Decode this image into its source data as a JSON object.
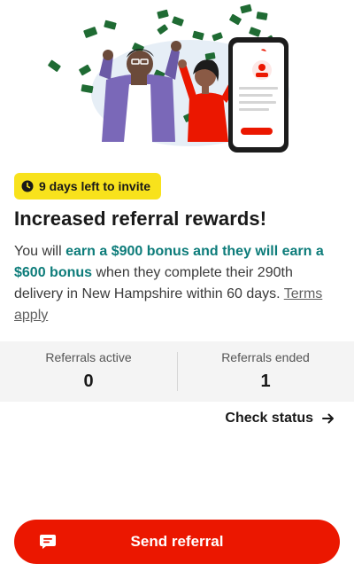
{
  "invite_badge": {
    "icon": "clock-icon",
    "text": "9 days left to invite"
  },
  "headline": "Increased referral rewards!",
  "description": {
    "prefix": "You will ",
    "highlight": "earn a $900 bonus and they will earn a $600 bonus",
    "middle": " when they complete their 290th delivery in New Hampshire within 60 days. ",
    "terms_link": "Terms apply"
  },
  "stats": [
    {
      "label": "Referrals active",
      "value": "0"
    },
    {
      "label": "Referrals ended",
      "value": "1"
    }
  ],
  "check_status": {
    "label": "Check status",
    "icon": "arrow-right-icon"
  },
  "send_button": {
    "label": "Send referral",
    "icon": "chat-bubble-icon"
  },
  "colors": {
    "brand_red": "#eb1700",
    "badge_yellow": "#f8e21c",
    "highlight_teal": "#0d7c7a",
    "stats_bg": "#f4f4f4"
  }
}
